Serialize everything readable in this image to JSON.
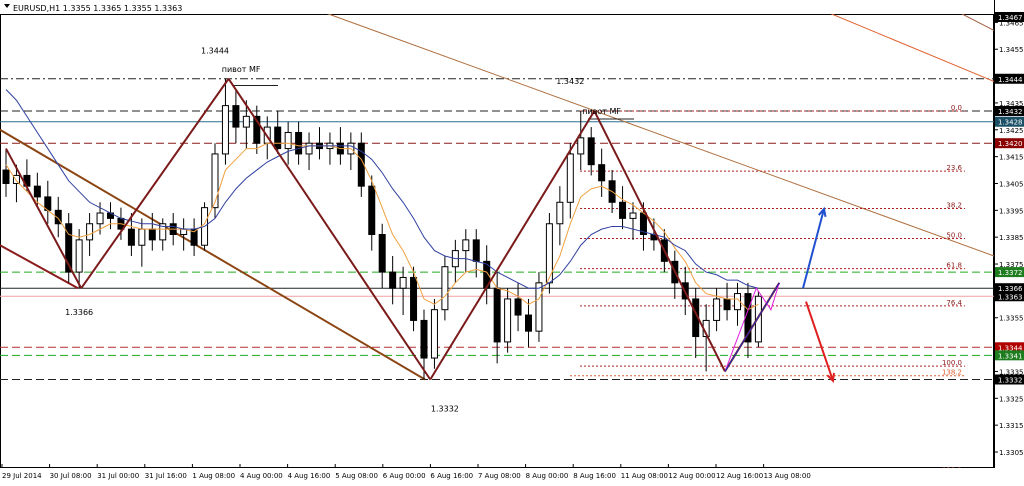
{
  "header": {
    "symbol_line": "EURUSD,H1  1.3355 1.3365 1.3355 1.3363"
  },
  "chart_data": {
    "type": "candlestick",
    "symbol": "EURUSD",
    "timeframe": "H1",
    "ohlc": {
      "open": 1.3355,
      "high": 1.3365,
      "low": 1.3355,
      "close": 1.3363
    },
    "ylim": [
      1.3295,
      1.3475
    ],
    "y_ticks": [
      1.3305,
      1.3315,
      1.3325,
      1.3335,
      1.3345,
      1.3355,
      1.3365,
      1.3375,
      1.3385,
      1.3395,
      1.3405,
      1.3415,
      1.3425,
      1.3435,
      1.3445,
      1.3455,
      1.3465
    ],
    "x_labels": [
      "29 Jul 2014",
      "30 Jul 08:00",
      "31 Jul 00:00",
      "31 Jul 16:00",
      "1 Aug 08:00",
      "4 Aug 00:00",
      "4 Aug 16:00",
      "5 Aug 08:00",
      "6 Aug 00:00",
      "6 Aug 16:00",
      "7 Aug 08:00",
      "8 Aug 00:00",
      "8 Aug 16:00",
      "11 Aug 08:00",
      "12 Aug 00:00",
      "12 Aug 16:00",
      "13 Aug 08:00"
    ],
    "price_markers": [
      {
        "label": "1.3467",
        "value": 1.3467,
        "color": "#000000"
      },
      {
        "label": "1.3444",
        "value": 1.3444,
        "color": "#000000"
      },
      {
        "label": "1.3432",
        "value": 1.3432,
        "color": "#000000"
      },
      {
        "label": "1.3428",
        "value": 1.3428,
        "color": "#1a4f66"
      },
      {
        "label": "1.3420",
        "value": 1.342,
        "color": "#8b0000"
      },
      {
        "label": "1.3372",
        "value": 1.3372,
        "color": "#1e7d1e"
      },
      {
        "label": "1.3366",
        "value": 1.3366,
        "color": "#000000"
      },
      {
        "label": "1.3363",
        "value": 1.3363,
        "color": "#000000"
      },
      {
        "label": "1.3344",
        "value": 1.3344,
        "color": "#b00000"
      },
      {
        "label": "1.3341",
        "value": 1.3341,
        "color": "#1e7d1e"
      },
      {
        "label": "1.3332",
        "value": 1.3332,
        "color": "#000000"
      }
    ],
    "horizontal_levels": [
      {
        "value": 1.3444,
        "style": "dashdot",
        "color": "#222222"
      },
      {
        "value": 1.3432,
        "style": "dash",
        "color": "#222222"
      },
      {
        "value": 1.3428,
        "style": "solid",
        "color": "#2b6f8f"
      },
      {
        "value": 1.342,
        "style": "dash",
        "color": "#8b1a1a"
      },
      {
        "value": 1.3372,
        "style": "dash",
        "color": "#22aa22"
      },
      {
        "value": 1.3366,
        "style": "solid",
        "color": "#222222"
      },
      {
        "value": 1.3363,
        "style": "solid",
        "color": "#f0a0a0"
      },
      {
        "value": 1.3344,
        "style": "dash",
        "color": "#b03030"
      },
      {
        "value": 1.3341,
        "style": "dash",
        "color": "#22aa22"
      },
      {
        "value": 1.3332,
        "style": "dash",
        "color": "#222222"
      }
    ],
    "fibonacci": [
      {
        "label": "0.0",
        "value": 1.3432
      },
      {
        "label": "23.6",
        "value": 1.34096
      },
      {
        "label": "38.2",
        "value": 1.33957
      },
      {
        "label": "50.0",
        "value": 1.33845
      },
      {
        "label": "61.8",
        "value": 1.33733
      },
      {
        "label": "76.4",
        "value": 1.33594
      },
      {
        "label": "100.0",
        "value": 1.3337
      },
      {
        "label": "138.2",
        "value": 1.33334
      },
      {
        "label": "138.2",
        "value": 1.3297
      }
    ],
    "annotations": [
      {
        "text": "1.3444",
        "x_index": 20,
        "value": 1.34535
      },
      {
        "text": "1.3432",
        "x_index": 54,
        "value": 1.3442
      },
      {
        "text": "1.3366",
        "x_index": 7,
        "value": 1.3356
      },
      {
        "text": "1.3332",
        "x_index": 42,
        "value": 1.332
      },
      {
        "text": "пивот МF",
        "x_index": 22.5,
        "value": 1.34465
      },
      {
        "text": "пивот МF",
        "x_index": 57,
        "value": 1.34308
      }
    ],
    "zigzag": [
      {
        "x_index": 0,
        "value": 1.3418
      },
      {
        "x_index": 7.2,
        "value": 1.3366
      },
      {
        "x_index": 21.3,
        "value": 1.3444
      },
      {
        "x_index": 40.6,
        "value": 1.3332
      },
      {
        "x_index": 56.3,
        "value": 1.3432
      },
      {
        "x_index": 68.8,
        "value": 1.3335
      },
      {
        "x_index": 74,
        "value": 1.3368
      }
    ],
    "candles": [
      {
        "o": 1.341,
        "h": 1.3418,
        "l": 1.34,
        "c": 1.3405
      },
      {
        "o": 1.3405,
        "h": 1.3412,
        "l": 1.3398,
        "c": 1.3408
      },
      {
        "o": 1.3408,
        "h": 1.3414,
        "l": 1.3402,
        "c": 1.3404
      },
      {
        "o": 1.3404,
        "h": 1.3409,
        "l": 1.3396,
        "c": 1.34
      },
      {
        "o": 1.34,
        "h": 1.3406,
        "l": 1.339,
        "c": 1.3395
      },
      {
        "o": 1.3395,
        "h": 1.34,
        "l": 1.3385,
        "c": 1.339
      },
      {
        "o": 1.339,
        "h": 1.3394,
        "l": 1.3368,
        "c": 1.3372
      },
      {
        "o": 1.3372,
        "h": 1.3388,
        "l": 1.3366,
        "c": 1.3384
      },
      {
        "o": 1.3384,
        "h": 1.3394,
        "l": 1.3378,
        "c": 1.339
      },
      {
        "o": 1.339,
        "h": 1.3398,
        "l": 1.3386,
        "c": 1.3394
      },
      {
        "o": 1.3394,
        "h": 1.3398,
        "l": 1.3388,
        "c": 1.3392
      },
      {
        "o": 1.3392,
        "h": 1.3396,
        "l": 1.3384,
        "c": 1.3388
      },
      {
        "o": 1.3388,
        "h": 1.3394,
        "l": 1.3378,
        "c": 1.3382
      },
      {
        "o": 1.3382,
        "h": 1.3392,
        "l": 1.3374,
        "c": 1.3388
      },
      {
        "o": 1.3388,
        "h": 1.3394,
        "l": 1.338,
        "c": 1.3384
      },
      {
        "o": 1.3384,
        "h": 1.3392,
        "l": 1.338,
        "c": 1.339
      },
      {
        "o": 1.339,
        "h": 1.3394,
        "l": 1.3382,
        "c": 1.3386
      },
      {
        "o": 1.3386,
        "h": 1.3392,
        "l": 1.338,
        "c": 1.3388
      },
      {
        "o": 1.3388,
        "h": 1.3392,
        "l": 1.3378,
        "c": 1.3382
      },
      {
        "o": 1.3382,
        "h": 1.3398,
        "l": 1.338,
        "c": 1.3396
      },
      {
        "o": 1.3396,
        "h": 1.342,
        "l": 1.3392,
        "c": 1.3416
      },
      {
        "o": 1.3416,
        "h": 1.3444,
        "l": 1.3412,
        "c": 1.3434
      },
      {
        "o": 1.3434,
        "h": 1.344,
        "l": 1.342,
        "c": 1.3426
      },
      {
        "o": 1.3426,
        "h": 1.3436,
        "l": 1.3418,
        "c": 1.343
      },
      {
        "o": 1.343,
        "h": 1.3434,
        "l": 1.3416,
        "c": 1.342
      },
      {
        "o": 1.342,
        "h": 1.343,
        "l": 1.3414,
        "c": 1.3426
      },
      {
        "o": 1.3426,
        "h": 1.3432,
        "l": 1.3416,
        "c": 1.3418
      },
      {
        "o": 1.3418,
        "h": 1.3428,
        "l": 1.3412,
        "c": 1.3424
      },
      {
        "o": 1.3424,
        "h": 1.3428,
        "l": 1.3412,
        "c": 1.3416
      },
      {
        "o": 1.3416,
        "h": 1.3424,
        "l": 1.341,
        "c": 1.342
      },
      {
        "o": 1.342,
        "h": 1.3426,
        "l": 1.3414,
        "c": 1.3418
      },
      {
        "o": 1.3418,
        "h": 1.3424,
        "l": 1.3412,
        "c": 1.342
      },
      {
        "o": 1.342,
        "h": 1.3426,
        "l": 1.3412,
        "c": 1.3416
      },
      {
        "o": 1.3416,
        "h": 1.3424,
        "l": 1.341,
        "c": 1.342
      },
      {
        "o": 1.342,
        "h": 1.3424,
        "l": 1.34,
        "c": 1.3404
      },
      {
        "o": 1.3404,
        "h": 1.3408,
        "l": 1.338,
        "c": 1.3386
      },
      {
        "o": 1.3386,
        "h": 1.339,
        "l": 1.3366,
        "c": 1.3372
      },
      {
        "o": 1.3372,
        "h": 1.3378,
        "l": 1.336,
        "c": 1.3366
      },
      {
        "o": 1.3366,
        "h": 1.3374,
        "l": 1.3356,
        "c": 1.337
      },
      {
        "o": 1.337,
        "h": 1.3374,
        "l": 1.335,
        "c": 1.3354
      },
      {
        "o": 1.3354,
        "h": 1.3358,
        "l": 1.3332,
        "c": 1.334
      },
      {
        "o": 1.334,
        "h": 1.3362,
        "l": 1.3336,
        "c": 1.3358
      },
      {
        "o": 1.3358,
        "h": 1.3378,
        "l": 1.3354,
        "c": 1.3374
      },
      {
        "o": 1.3374,
        "h": 1.3384,
        "l": 1.3368,
        "c": 1.338
      },
      {
        "o": 1.338,
        "h": 1.3388,
        "l": 1.3372,
        "c": 1.3384
      },
      {
        "o": 1.3384,
        "h": 1.3388,
        "l": 1.337,
        "c": 1.3376
      },
      {
        "o": 1.3376,
        "h": 1.3382,
        "l": 1.336,
        "c": 1.3366
      },
      {
        "o": 1.3366,
        "h": 1.3372,
        "l": 1.3338,
        "c": 1.3346
      },
      {
        "o": 1.3346,
        "h": 1.3366,
        "l": 1.3342,
        "c": 1.3362
      },
      {
        "o": 1.3362,
        "h": 1.3368,
        "l": 1.335,
        "c": 1.3356
      },
      {
        "o": 1.3356,
        "h": 1.3362,
        "l": 1.3344,
        "c": 1.335
      },
      {
        "o": 1.335,
        "h": 1.3372,
        "l": 1.3346,
        "c": 1.3368
      },
      {
        "o": 1.3368,
        "h": 1.3394,
        "l": 1.3364,
        "c": 1.339
      },
      {
        "o": 1.339,
        "h": 1.3404,
        "l": 1.3382,
        "c": 1.3398
      },
      {
        "o": 1.3398,
        "h": 1.342,
        "l": 1.3392,
        "c": 1.3416
      },
      {
        "o": 1.3416,
        "h": 1.3432,
        "l": 1.341,
        "c": 1.3422
      },
      {
        "o": 1.3422,
        "h": 1.3426,
        "l": 1.3408,
        "c": 1.3412
      },
      {
        "o": 1.3412,
        "h": 1.3418,
        "l": 1.34,
        "c": 1.3406
      },
      {
        "o": 1.3406,
        "h": 1.341,
        "l": 1.3394,
        "c": 1.3398
      },
      {
        "o": 1.3398,
        "h": 1.3404,
        "l": 1.3388,
        "c": 1.3392
      },
      {
        "o": 1.3392,
        "h": 1.3398,
        "l": 1.3384,
        "c": 1.3394
      },
      {
        "o": 1.3394,
        "h": 1.3398,
        "l": 1.338,
        "c": 1.3386
      },
      {
        "o": 1.3386,
        "h": 1.3392,
        "l": 1.338,
        "c": 1.3384
      },
      {
        "o": 1.3384,
        "h": 1.3388,
        "l": 1.3372,
        "c": 1.3376
      },
      {
        "o": 1.3376,
        "h": 1.338,
        "l": 1.3362,
        "c": 1.3368
      },
      {
        "o": 1.3368,
        "h": 1.3374,
        "l": 1.3356,
        "c": 1.3362
      },
      {
        "o": 1.3362,
        "h": 1.3366,
        "l": 1.334,
        "c": 1.3348
      },
      {
        "o": 1.3348,
        "h": 1.336,
        "l": 1.3335,
        "c": 1.3354
      },
      {
        "o": 1.3354,
        "h": 1.3366,
        "l": 1.335,
        "c": 1.3362
      },
      {
        "o": 1.3362,
        "h": 1.3368,
        "l": 1.3354,
        "c": 1.3358
      },
      {
        "o": 1.3358,
        "h": 1.3368,
        "l": 1.3352,
        "c": 1.3364
      },
      {
        "o": 1.3364,
        "h": 1.3368,
        "l": 1.334,
        "c": 1.3346
      },
      {
        "o": 1.3346,
        "h": 1.3365,
        "l": 1.3344,
        "c": 1.3363
      }
    ],
    "moving_averages": [
      {
        "name": "",
        "color": "#f0a040",
        "values": [
          1.3412,
          1.3406,
          1.3402,
          1.3398,
          1.3395,
          1.3392,
          1.3386,
          1.3385,
          1.3386,
          1.3388,
          1.339,
          1.339,
          1.3389,
          1.3388,
          1.3388,
          1.3388,
          1.3388,
          1.3388,
          1.3387,
          1.339,
          1.3398,
          1.341,
          1.3414,
          1.3418,
          1.3418,
          1.342,
          1.342,
          1.342,
          1.3419,
          1.3419,
          1.3419,
          1.3419,
          1.3418,
          1.3418,
          1.3414,
          1.3406,
          1.3396,
          1.3386,
          1.338,
          1.3372,
          1.3362,
          1.336,
          1.3363,
          1.3368,
          1.3372,
          1.3373,
          1.3372,
          1.3366,
          1.3365,
          1.3363,
          1.336,
          1.3362,
          1.337,
          1.3378,
          1.339,
          1.34,
          1.3403,
          1.3404,
          1.3402,
          1.3399,
          1.3397,
          1.3394,
          1.3391,
          1.3387,
          1.3381,
          1.3376,
          1.3368,
          1.3364,
          1.3363,
          1.3362,
          1.3362,
          1.3358,
          1.336
        ]
      },
      {
        "name": "",
        "color": "#3040a0",
        "values": [
          1.344,
          1.3436,
          1.343,
          1.3424,
          1.3418,
          1.3412,
          1.3406,
          1.3402,
          1.3398,
          1.3396,
          1.3394,
          1.3392,
          1.3391,
          1.339,
          1.339,
          1.3389,
          1.3389,
          1.3388,
          1.3388,
          1.3389,
          1.3392,
          1.3398,
          1.3403,
          1.3407,
          1.341,
          1.3413,
          1.3415,
          1.3417,
          1.3418,
          1.3419,
          1.3419,
          1.3419,
          1.3419,
          1.3419,
          1.3417,
          1.3414,
          1.3409,
          1.3403,
          1.3398,
          1.3392,
          1.3385,
          1.338,
          1.3378,
          1.3377,
          1.3377,
          1.3376,
          1.3375,
          1.3372,
          1.337,
          1.3368,
          1.3366,
          1.3366,
          1.3368,
          1.3371,
          1.3376,
          1.3382,
          1.3386,
          1.3388,
          1.3389,
          1.3389,
          1.3388,
          1.3387,
          1.3386,
          1.3385,
          1.3382,
          1.338,
          1.3375,
          1.3372,
          1.3371,
          1.3369,
          1.3369,
          1.3367,
          1.3366
        ]
      }
    ]
  }
}
